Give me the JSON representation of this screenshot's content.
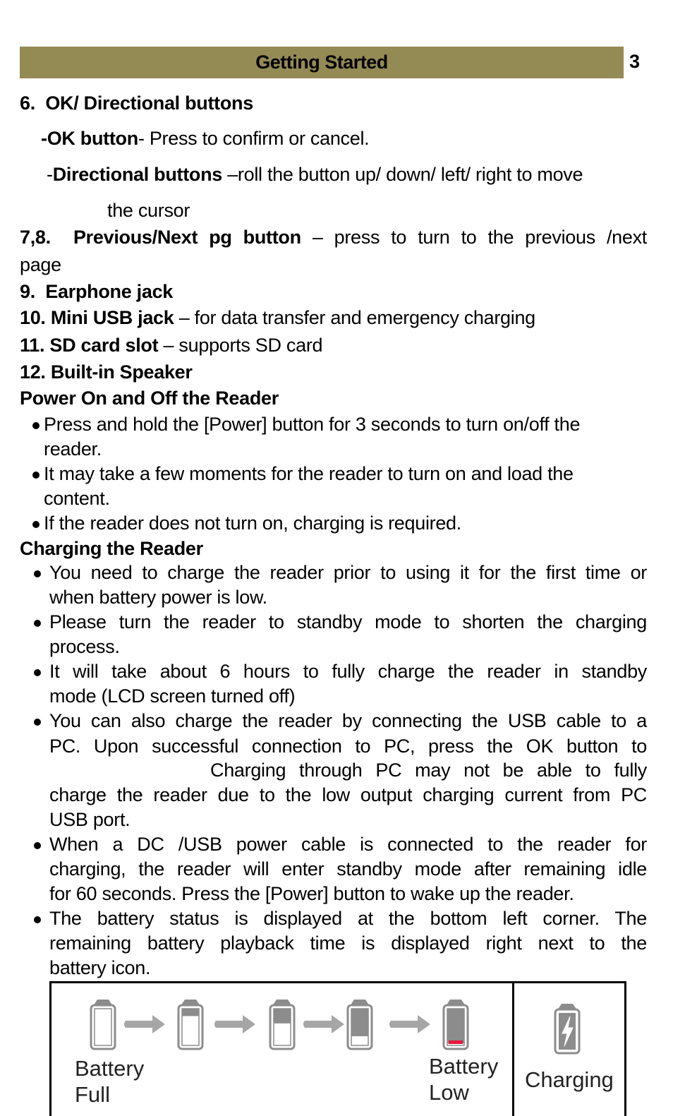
{
  "header": {
    "title": "Getting Started",
    "page_number": "3",
    "bar_color": "#948a54"
  },
  "items": {
    "item6": {
      "number": "6.",
      "title": "OK/ Directional buttons"
    },
    "ok_button": {
      "label": "-OK button",
      "text": "- Press to confirm or cancel."
    },
    "directional": {
      "prefix": "-",
      "label": "Directional buttons",
      "text": " –roll the button up/ down/ left/ right to move",
      "continuation": "the cursor"
    },
    "item78": {
      "number": "7,8.",
      "title": "Previous/Next pg button",
      "text": " – press to turn to the previous /next",
      "continuation": "page"
    },
    "item9": {
      "number": "9.",
      "title": "Earphone jack"
    },
    "item10": {
      "number": "10.",
      "title": "Mini USB jack",
      "text": " – for data transfer and emergency charging"
    },
    "item11": {
      "number": "11.",
      "title": "SD card slot",
      "text": " – supports SD card"
    },
    "item12": {
      "number": "12.",
      "title": "Built-in Speaker"
    }
  },
  "power_section": {
    "heading": "Power On and Off  the Reader",
    "bullets": [
      {
        "line1": "Press and hold the [Power] button for 3 seconds to turn on/off the",
        "line2": "reader."
      },
      {
        "line1": "It may take a few moments for the reader to turn on and load the",
        "line2": "content."
      },
      {
        "line1": "If the reader does not turn on, charging is required."
      }
    ]
  },
  "charging_section": {
    "heading": "Charging the Reader",
    "bullets": [
      {
        "lines": [
          "You need to charge the reader prior to using it for the first time or",
          "when battery power is low."
        ]
      },
      {
        "lines": [
          "Please turn the reader to standby mode to shorten the charging",
          "process."
        ]
      },
      {
        "lines": [
          "It will take about 6 hours to fully charge the reader in standby",
          "mode (LCD screen turned off)"
        ]
      },
      {
        "lines": [
          "You can also charge the reader by connecting the USB cable to a",
          "PC. Upon successful connection to PC, press the OK button to",
          "Charging through PC may not be able to fully",
          "charge the reader due to the low output charging current from PC",
          "USB port."
        ]
      },
      {
        "lines": [
          "When a DC /USB power cable is connected to the reader for",
          "charging, the reader will enter standby mode after remaining idle",
          "for 60 seconds. Press the [Power] button to wake up the reader."
        ]
      },
      {
        "lines": [
          "The battery status is displayed at the bottom left corner. The",
          "remaining battery playback time is displayed right next to the",
          "battery icon."
        ]
      }
    ]
  },
  "battery_table": {
    "levels": [
      {
        "name": "battery-full",
        "fill_fraction": 1.0
      },
      {
        "name": "battery-3of4",
        "fill_fraction": 0.8
      },
      {
        "name": "battery-half",
        "fill_fraction": 0.6
      },
      {
        "name": "battery-quarter",
        "fill_fraction": 0.25
      },
      {
        "name": "battery-low",
        "fill_fraction": 0.05
      }
    ],
    "label_full_1": "Battery",
    "label_full_2": "Full",
    "label_low_1": "Battery",
    "label_low_2": "Low",
    "label_charging": "Charging",
    "low_color": "#e8193c",
    "icon_color": "#8c8c8c",
    "arrow_color": "#a6a6a6"
  }
}
